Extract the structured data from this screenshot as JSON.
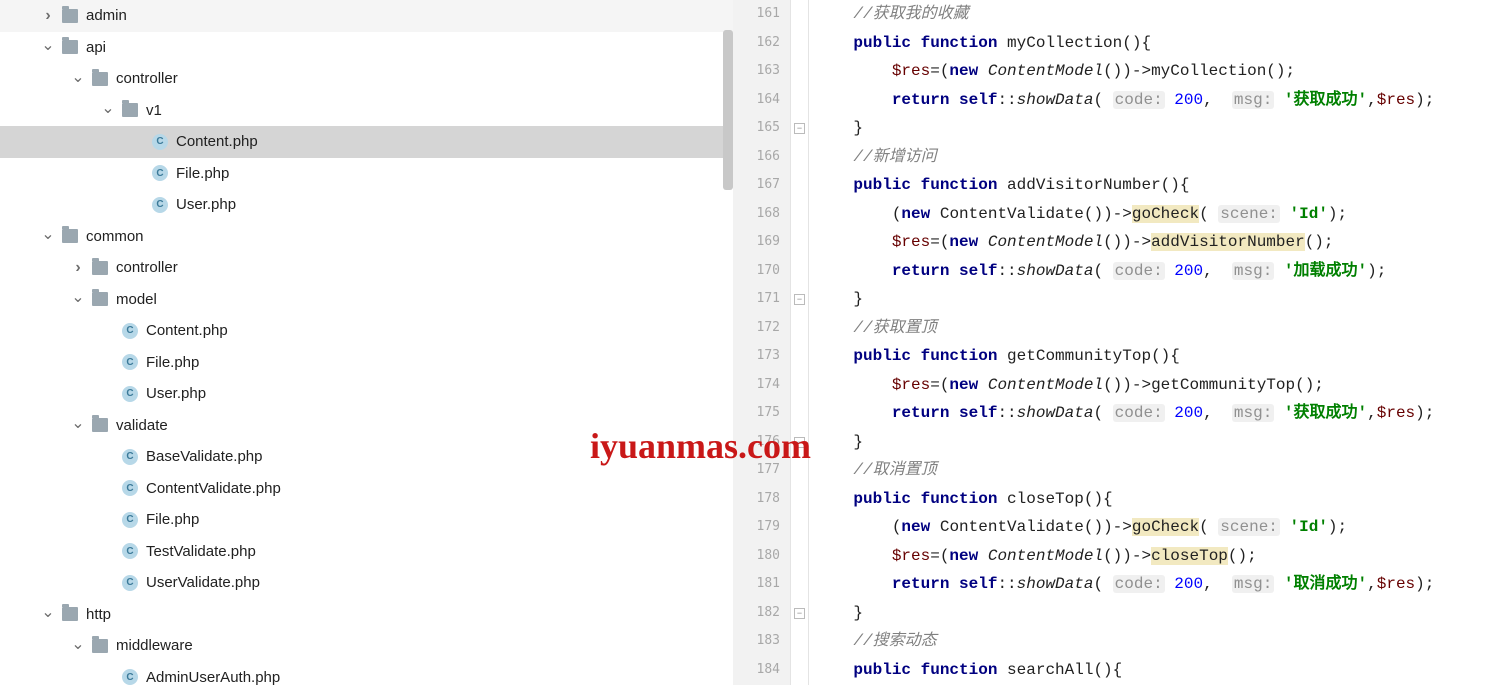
{
  "watermark": "iyuanmas.com",
  "tree": [
    {
      "depth": 0,
      "chev": "right",
      "icon": "folder",
      "label": "admin",
      "sel": false
    },
    {
      "depth": 0,
      "chev": "down",
      "icon": "folder",
      "label": "api",
      "sel": false
    },
    {
      "depth": 1,
      "chev": "down",
      "icon": "folder",
      "label": "controller",
      "sel": false
    },
    {
      "depth": 2,
      "chev": "down",
      "icon": "folder",
      "label": "v1",
      "sel": false
    },
    {
      "depth": 3,
      "chev": "",
      "icon": "class",
      "label": "Content.php",
      "sel": true
    },
    {
      "depth": 3,
      "chev": "",
      "icon": "class",
      "label": "File.php",
      "sel": false
    },
    {
      "depth": 3,
      "chev": "",
      "icon": "class",
      "label": "User.php",
      "sel": false
    },
    {
      "depth": 0,
      "chev": "down",
      "icon": "folder",
      "label": "common",
      "sel": false
    },
    {
      "depth": 1,
      "chev": "right",
      "icon": "folder",
      "label": "controller",
      "sel": false
    },
    {
      "depth": 1,
      "chev": "down",
      "icon": "folder",
      "label": "model",
      "sel": false
    },
    {
      "depth": 2,
      "chev": "",
      "icon": "class",
      "label": "Content.php",
      "sel": false
    },
    {
      "depth": 2,
      "chev": "",
      "icon": "class",
      "label": "File.php",
      "sel": false
    },
    {
      "depth": 2,
      "chev": "",
      "icon": "class",
      "label": "User.php",
      "sel": false
    },
    {
      "depth": 1,
      "chev": "down",
      "icon": "folder",
      "label": "validate",
      "sel": false
    },
    {
      "depth": 2,
      "chev": "",
      "icon": "class",
      "label": "BaseValidate.php",
      "sel": false
    },
    {
      "depth": 2,
      "chev": "",
      "icon": "class",
      "label": "ContentValidate.php",
      "sel": false
    },
    {
      "depth": 2,
      "chev": "",
      "icon": "class",
      "label": "File.php",
      "sel": false
    },
    {
      "depth": 2,
      "chev": "",
      "icon": "class",
      "label": "TestValidate.php",
      "sel": false
    },
    {
      "depth": 2,
      "chev": "",
      "icon": "class",
      "label": "UserValidate.php",
      "sel": false
    },
    {
      "depth": 0,
      "chev": "down",
      "icon": "folder",
      "label": "http",
      "sel": false
    },
    {
      "depth": 1,
      "chev": "down",
      "icon": "folder",
      "label": "middleware",
      "sel": false
    },
    {
      "depth": 2,
      "chev": "",
      "icon": "class",
      "label": "AdminUserAuth.php",
      "sel": false
    }
  ],
  "line_start": 161,
  "line_end": 184,
  "fold_marks": [
    {
      "line": 165,
      "sym": "−"
    },
    {
      "line": 171,
      "sym": "−"
    },
    {
      "line": 176,
      "sym": "−"
    },
    {
      "line": 182,
      "sym": "−"
    }
  ],
  "code": [
    {
      "i": 1,
      "html": "<span class='cm'>//获取我的收藏</span>"
    },
    {
      "i": 1,
      "html": "<span class='kw'>public</span> <span class='kw'>function</span> myCollection(){"
    },
    {
      "i": 2,
      "html": "<span class='var'>$res</span>=(<span class='kw'>new</span> <span class='fn-it'>ContentModel</span>())-&gt;myCollection();"
    },
    {
      "i": 2,
      "html": "<span class='kw'>return</span> <span class='kw'>self</span>::<span class='fn-it'>showData</span>( <span class='hint'>code:</span> <span class='num'>200</span>,  <span class='hint'>msg:</span> <span class='str'>'获取成功'</span>,<span class='var'>$res</span>);"
    },
    {
      "i": 1,
      "html": "}"
    },
    {
      "i": 1,
      "html": "<span class='cm'>//新增访问</span>"
    },
    {
      "i": 1,
      "html": "<span class='kw'>public</span> <span class='kw'>function</span> addVisitorNumber(){"
    },
    {
      "i": 2,
      "html": "(<span class='kw'>new</span> ContentValidate())-&gt;<span class='hl'>goCheck</span>( <span class='hint'>scene:</span> <span class='str'>'Id'</span>);"
    },
    {
      "i": 2,
      "html": "<span class='var'>$res</span>=(<span class='kw'>new</span> <span class='fn-it'>ContentModel</span>())-&gt;<span class='hl'>addVisitorNumber</span>();"
    },
    {
      "i": 2,
      "html": "<span class='kw'>return</span> <span class='kw'>self</span>::<span class='fn-it'>showData</span>( <span class='hint'>code:</span> <span class='num'>200</span>,  <span class='hint'>msg:</span> <span class='str'>'加载成功'</span>);"
    },
    {
      "i": 1,
      "html": "}"
    },
    {
      "i": 1,
      "html": "<span class='cm'>//获取置顶</span>"
    },
    {
      "i": 1,
      "html": "<span class='kw'>public</span> <span class='kw'>function</span> getCommunityTop(){"
    },
    {
      "i": 2,
      "html": "<span class='var'>$res</span>=(<span class='kw'>new</span> <span class='fn-it'>ContentModel</span>())-&gt;getCommunityTop();"
    },
    {
      "i": 2,
      "html": "<span class='kw'>return</span> <span class='kw'>self</span>::<span class='fn-it'>showData</span>( <span class='hint'>code:</span> <span class='num'>200</span>,  <span class='hint'>msg:</span> <span class='str'>'获取成功'</span>,<span class='var'>$res</span>);"
    },
    {
      "i": 1,
      "html": "}"
    },
    {
      "i": 1,
      "html": "<span class='cm'>//取消置顶</span>"
    },
    {
      "i": 1,
      "html": "<span class='kw'>public</span> <span class='kw'>function</span> closeTop(){"
    },
    {
      "i": 2,
      "html": "(<span class='kw'>new</span> ContentValidate())-&gt;<span class='hl'>goCheck</span>( <span class='hint'>scene:</span> <span class='str'>'Id'</span>);"
    },
    {
      "i": 2,
      "html": "<span class='var'>$res</span>=(<span class='kw'>new</span> <span class='fn-it'>ContentModel</span>())-&gt;<span class='hl'>closeTop</span>();"
    },
    {
      "i": 2,
      "html": "<span class='kw'>return</span> <span class='kw'>self</span>::<span class='fn-it'>showData</span>( <span class='hint'>code:</span> <span class='num'>200</span>,  <span class='hint'>msg:</span> <span class='str'>'取消成功'</span>,<span class='var'>$res</span>);"
    },
    {
      "i": 1,
      "html": "}"
    },
    {
      "i": 1,
      "html": "<span class='cm'>//搜索动态</span>"
    },
    {
      "i": 1,
      "html": "<span class='kw'>public</span> <span class='kw'>function</span> searchAll(){"
    }
  ]
}
